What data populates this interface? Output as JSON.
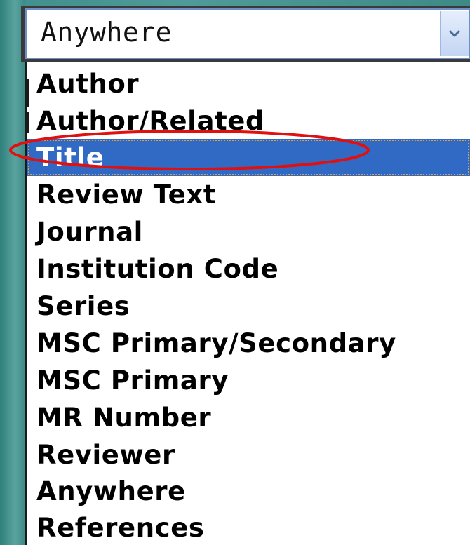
{
  "select": {
    "current_value": "Anywhere",
    "arrow_icon": "chevron-down-icon"
  },
  "dropdown": {
    "options": [
      {
        "label": "Author"
      },
      {
        "label": "Author/Related"
      },
      {
        "label": "Title",
        "selected": true
      },
      {
        "label": "Review Text"
      },
      {
        "label": "Journal"
      },
      {
        "label": "Institution Code"
      },
      {
        "label": "Series"
      },
      {
        "label": "MSC Primary/Secondary"
      },
      {
        "label": "MSC Primary"
      },
      {
        "label": "MR Number"
      },
      {
        "label": "Reviewer"
      },
      {
        "label": "Anywhere"
      },
      {
        "label": "References"
      }
    ]
  },
  "colors": {
    "selected_background": "#316ac5",
    "annotation_ellipse": "#e01010",
    "page_background": "#4f9b98"
  }
}
